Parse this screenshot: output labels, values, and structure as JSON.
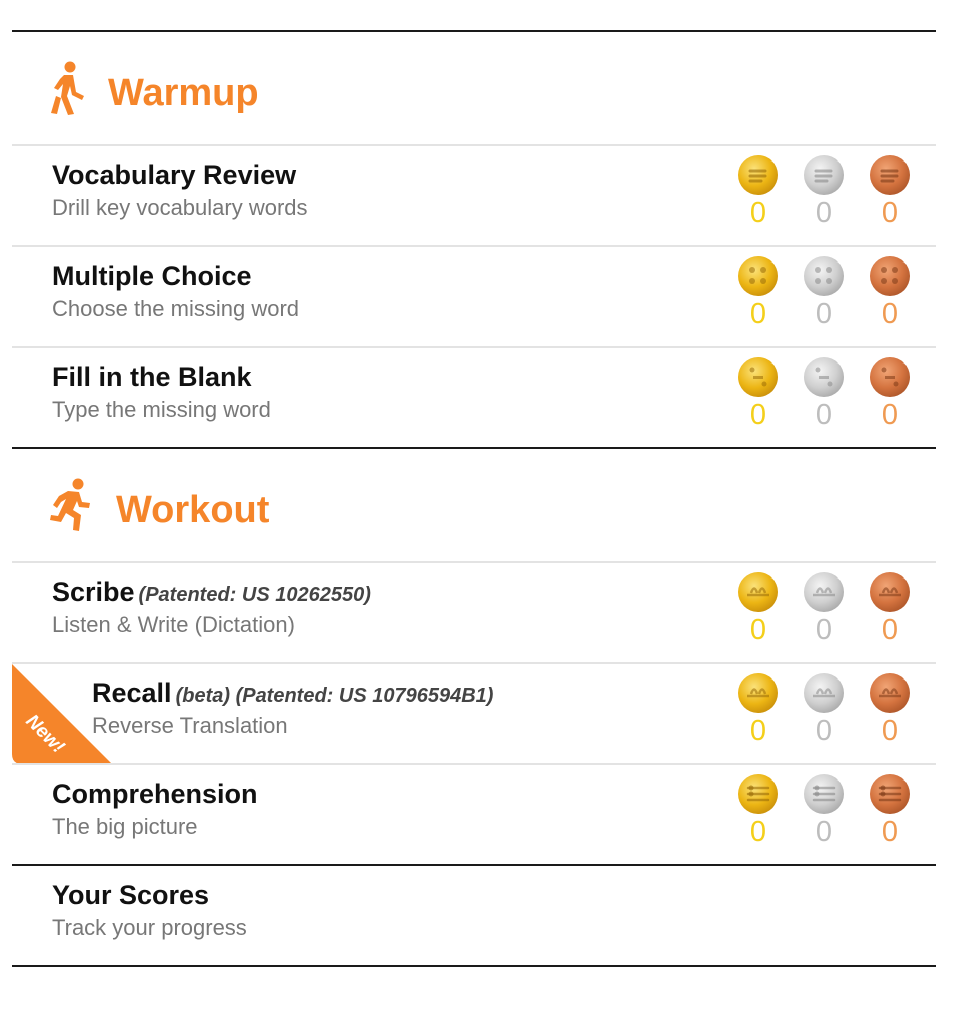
{
  "colors": {
    "accent": "#f5852a",
    "gold": "#f4cf1a",
    "silver": "#bdbdbd",
    "bronze": "#ef9a52"
  },
  "warmup": {
    "title": "Warmup",
    "icon": "walking-person-icon",
    "activities": [
      {
        "name": "Vocabulary Review",
        "desc": "Drill key vocabulary words",
        "gold": "0",
        "silver": "0",
        "bronze": "0"
      },
      {
        "name": "Multiple Choice",
        "desc": "Choose the missing word",
        "gold": "0",
        "silver": "0",
        "bronze": "0"
      },
      {
        "name": "Fill in the Blank",
        "desc": "Type the missing word",
        "gold": "0",
        "silver": "0",
        "bronze": "0"
      }
    ]
  },
  "workout": {
    "title": "Workout",
    "icon": "running-person-icon",
    "activities": [
      {
        "name": "Scribe",
        "note": "(Patented: US 10262550)",
        "desc": "Listen & Write (Dictation)",
        "gold": "0",
        "silver": "0",
        "bronze": "0"
      },
      {
        "name": "Recall",
        "note": "(beta) (Patented: US 10796594B1)",
        "desc": "Reverse Translation",
        "badge": "New!",
        "gold": "0",
        "silver": "0",
        "bronze": "0"
      },
      {
        "name": "Comprehension",
        "desc": "The big picture",
        "gold": "0",
        "silver": "0",
        "bronze": "0"
      }
    ]
  },
  "scores": {
    "name": "Your Scores",
    "desc": "Track your progress"
  }
}
